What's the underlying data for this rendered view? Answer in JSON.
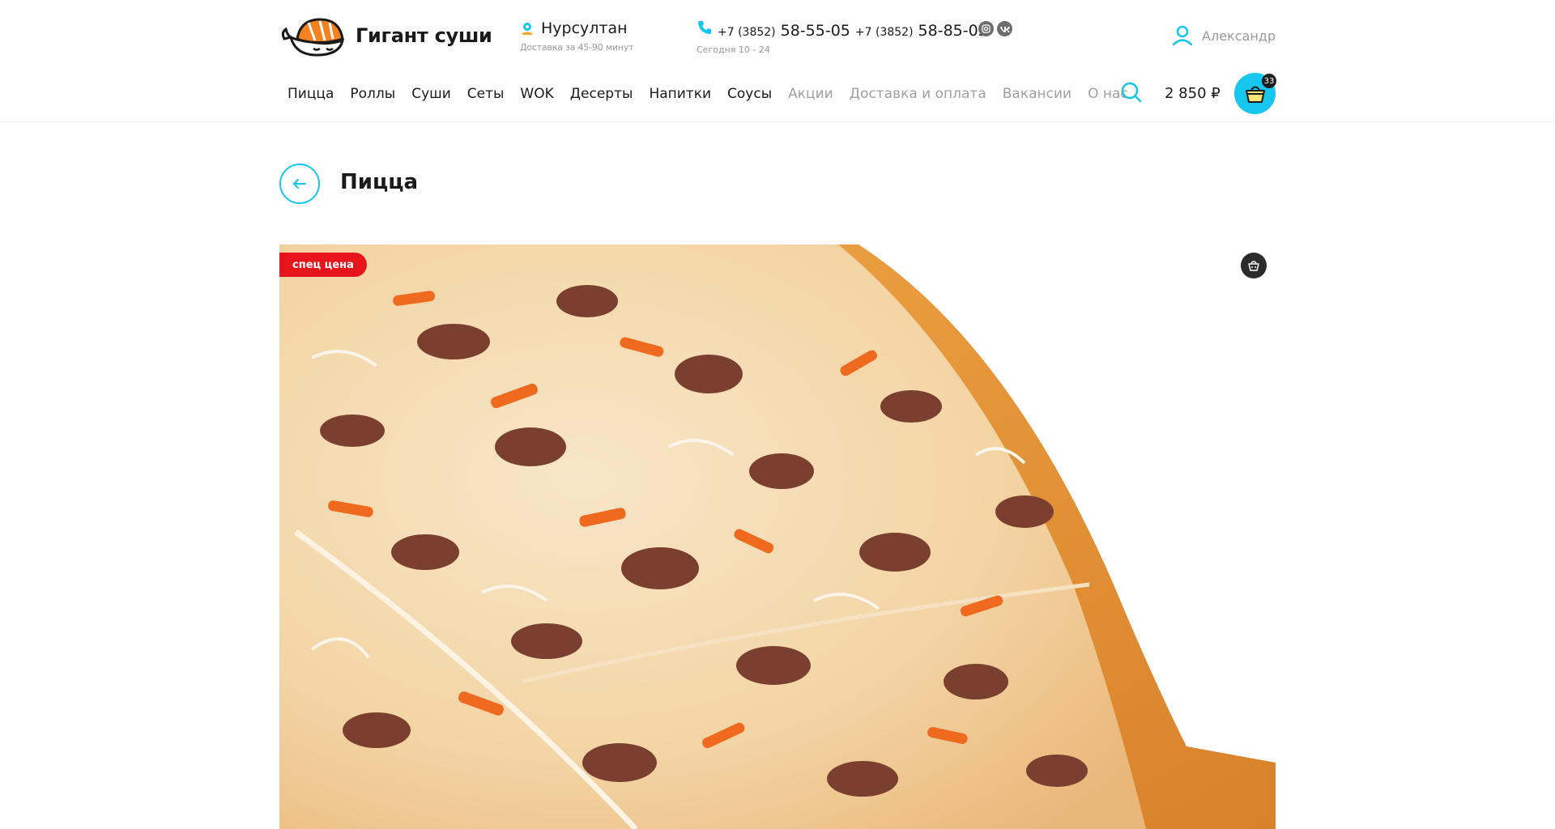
{
  "brand": {
    "name": "Гигант суши",
    "icon": "whale-sushi-logo"
  },
  "location": {
    "city": "Нурсултан",
    "delivery_time": "Доставка за 45-90 минут",
    "icon": "map-pin-icon"
  },
  "contacts": {
    "icon": "phone-icon",
    "phones": [
      {
        "code": "+7 (3852)",
        "number": "58-55-05"
      },
      {
        "code": "+7 (3852)",
        "number": "58-85-05"
      }
    ],
    "hours": "Сегодня 10 - 24",
    "socials": [
      "instagram-icon",
      "vk-icon"
    ]
  },
  "user": {
    "name": "Александр",
    "icon": "user-icon"
  },
  "nav": {
    "items": [
      {
        "label": "Пицца",
        "muted": false
      },
      {
        "label": "Роллы",
        "muted": false
      },
      {
        "label": "Суши",
        "muted": false
      },
      {
        "label": "Сеты",
        "muted": false
      },
      {
        "label": "WOK",
        "muted": false
      },
      {
        "label": "Десерты",
        "muted": false
      },
      {
        "label": "Напитки",
        "muted": false
      },
      {
        "label": "Соусы",
        "muted": false
      },
      {
        "label": "Акции",
        "muted": true
      },
      {
        "label": "Доставка и оплата",
        "muted": true
      },
      {
        "label": "Вакансии",
        "muted": true
      },
      {
        "label": "О нас",
        "muted": true
      }
    ]
  },
  "cart": {
    "total": "2 850 ₽",
    "count": "33",
    "icon": "basket-icon"
  },
  "page": {
    "title": "Пицца",
    "back_icon": "arrow-left-icon"
  },
  "product": {
    "badge": "спец цена",
    "favorite_icon": "basket-add-icon"
  },
  "colors": {
    "accent": "#17c6ef",
    "badge": "#e8141b",
    "logo_orange": "#f58220"
  }
}
